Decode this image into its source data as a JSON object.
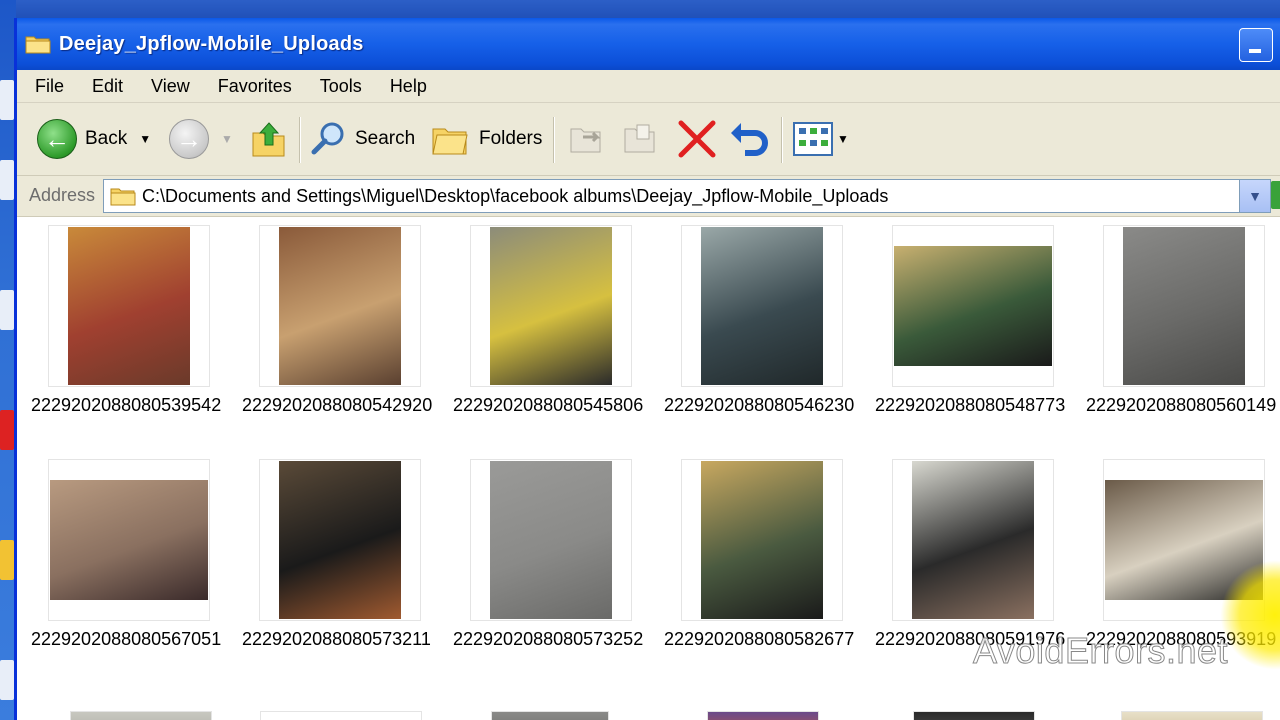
{
  "window": {
    "title": "Deejay_Jpflow-Mobile_Uploads"
  },
  "menu": [
    "File",
    "Edit",
    "View",
    "Favorites",
    "Tools",
    "Help"
  ],
  "toolbar": {
    "back_label": "Back",
    "search_label": "Search",
    "folders_label": "Folders"
  },
  "address": {
    "label": "Address",
    "value": "C:\\Documents and Settings\\Miguel\\Desktop\\facebook albums\\Deejay_Jpflow-Mobile_Uploads"
  },
  "files": [
    {
      "name": "2229202088080539542",
      "tone": [
        "#c98a3a",
        "#a04030",
        "#6a3a2a"
      ],
      "orient": "portrait"
    },
    {
      "name": "2229202088080542920",
      "tone": [
        "#8a5a3a",
        "#c8a070",
        "#5a4030"
      ],
      "orient": "portrait"
    },
    {
      "name": "2229202088080545806",
      "tone": [
        "#8c8c7a",
        "#d6c040",
        "#2a2a2a"
      ],
      "orient": "portrait"
    },
    {
      "name": "2229202088080546230",
      "tone": [
        "#9aa8a8",
        "#3a4a50",
        "#20282a"
      ],
      "orient": "portrait"
    },
    {
      "name": "2229202088080548773",
      "tone": [
        "#c8b070",
        "#3a5a3a",
        "#1a1a1a"
      ],
      "orient": "landscape"
    },
    {
      "name": "2229202088080560149",
      "tone": [
        "#8a8a88",
        "#6a6a68",
        "#4a4a48"
      ],
      "orient": "portrait"
    },
    {
      "name": "2229202088080567051",
      "tone": [
        "#b89a80",
        "#8a7060",
        "#3a2a2a"
      ],
      "orient": "landscape"
    },
    {
      "name": "2229202088080573211",
      "tone": [
        "#5a4a38",
        "#1a1a1a",
        "#a05a30"
      ],
      "orient": "portrait"
    },
    {
      "name": "2229202088080573252",
      "tone": [
        "#9a9a98",
        "#8a8a88",
        "#6a6a68"
      ],
      "orient": "portrait"
    },
    {
      "name": "2229202088080582677",
      "tone": [
        "#c8a860",
        "#4a5a40",
        "#1a1a1a"
      ],
      "orient": "portrait"
    },
    {
      "name": "2229202088080591976",
      "tone": [
        "#d8d8d0",
        "#2a2a2a",
        "#8a7060"
      ],
      "orient": "portrait"
    },
    {
      "name": "2229202088080593919",
      "tone": [
        "#6a5a48",
        "#d8d0c0",
        "#2a2a28"
      ],
      "orient": "landscape"
    }
  ],
  "watermark": "AvoidErrors.net",
  "colors": {
    "titlebar": "#0c4fd8",
    "chrome": "#ece9d8",
    "back_green": "#2e9b2a",
    "delete_red": "#e02020",
    "undo_blue": "#2060c8"
  }
}
